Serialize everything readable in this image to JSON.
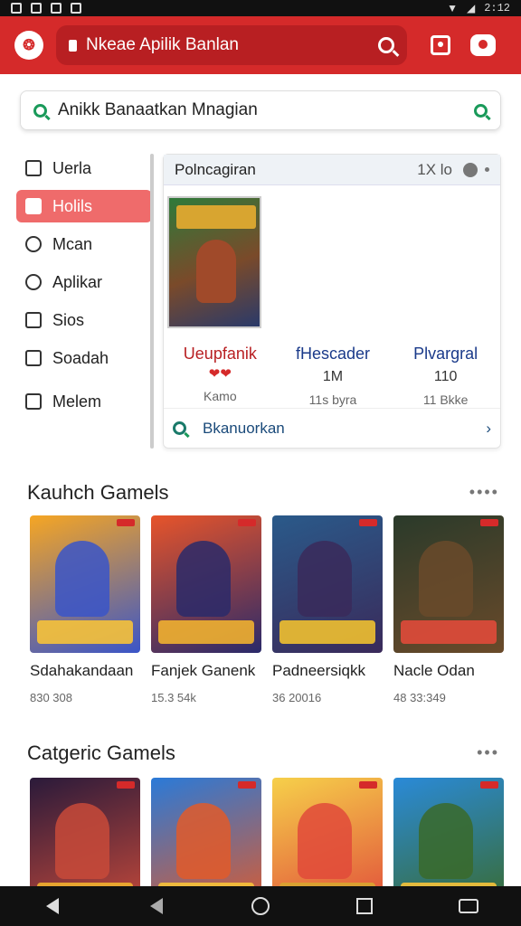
{
  "status": {
    "time": "2:12"
  },
  "header": {
    "search_label": "Nkeae Apilik Banlan"
  },
  "search2": {
    "text": "Anikk Banaatkan Mnagian"
  },
  "sidebar": {
    "items": [
      {
        "label": "Uerla",
        "icon": "list-icon",
        "active": false
      },
      {
        "label": "Holils",
        "icon": "bookmark-icon",
        "active": true
      },
      {
        "label": "Mcan",
        "icon": "refresh-icon",
        "active": false
      },
      {
        "label": "Aplikar",
        "icon": "share-icon",
        "active": false
      },
      {
        "label": "Sios",
        "icon": "person-icon",
        "active": false
      },
      {
        "label": "Soadah",
        "icon": "doc-icon",
        "active": false
      },
      {
        "label": "Melem",
        "icon": "puzzle-icon",
        "active": false
      }
    ]
  },
  "panel": {
    "title": "Polncagiran",
    "meta": "1X lo",
    "stats": [
      {
        "title": "Ueupfanik",
        "value": "",
        "sub": "Kamo",
        "hearts": "❤❤"
      },
      {
        "title": "fHescader",
        "value": "1M",
        "sub": "11s byra",
        "hearts": ""
      },
      {
        "title": "Plvargral",
        "value": "110",
        "sub": "11 Bkke",
        "hearts": ""
      }
    ],
    "footer": "Bkanuorkan"
  },
  "section1": {
    "title": "Kauhch Gamels",
    "cards": [
      {
        "name": "Sdahakandaan",
        "meta": "830 308",
        "colors": [
          "#f6a623",
          "#3a55c8",
          "#f6c23a"
        ]
      },
      {
        "name": "Fanjek Ganenk",
        "meta": "15.3 54k",
        "colors": [
          "#e7542a",
          "#2a2a6a",
          "#f0b030"
        ]
      },
      {
        "name": "Padneersiqkk",
        "meta": "36 20016",
        "colors": [
          "#2a5a8a",
          "#3a2a5a",
          "#f0c030"
        ]
      },
      {
        "name": "Nacle Odan",
        "meta": "48 33:349",
        "colors": [
          "#2a3a2a",
          "#6a4a2a",
          "#e04a3a"
        ]
      }
    ]
  },
  "section2": {
    "title": "Catgeric Gamels",
    "cards": [
      {
        "colors": [
          "#2a1a3a",
          "#c84a3a",
          "#f0b030"
        ]
      },
      {
        "colors": [
          "#2a7ad8",
          "#e05a2a",
          "#f6c23a"
        ]
      },
      {
        "colors": [
          "#f6d04a",
          "#e04a3a",
          "#d8a530"
        ]
      },
      {
        "colors": [
          "#2a8ad8",
          "#3a6a2a",
          "#f6c23a"
        ]
      }
    ]
  }
}
